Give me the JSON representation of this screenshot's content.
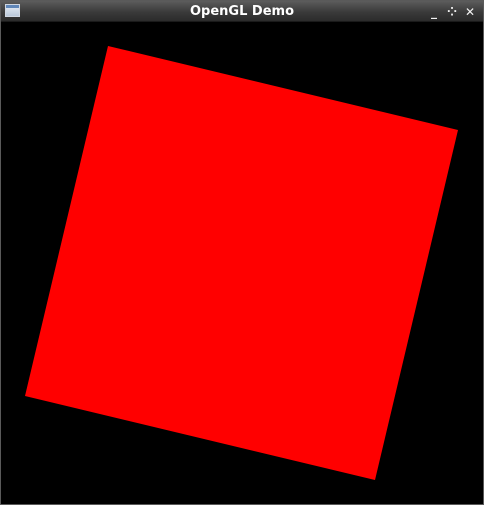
{
  "window": {
    "title": "OpenGL Demo",
    "controls": {
      "minimize_icon": "minimize-icon",
      "maximize_icon": "maximize-icon",
      "close_icon": "close-icon"
    }
  },
  "scene": {
    "background_color": "#000000",
    "shape": {
      "type": "square",
      "fill_color": "#ff0000",
      "rotation_deg": 15
    }
  }
}
